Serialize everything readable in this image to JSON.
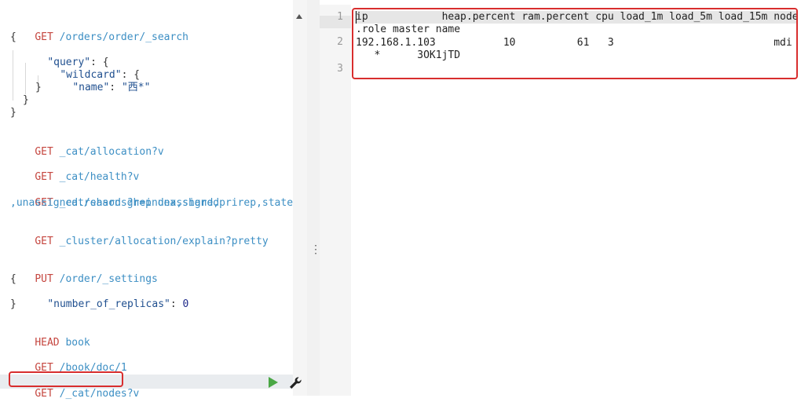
{
  "editor": {
    "lines": [
      {
        "method": "GET",
        "path": "/orders/order/_search"
      },
      {
        "text": "{"
      },
      {
        "key": "\"query\"",
        "rest": ": {"
      },
      {
        "key": "\"wildcard\"",
        "rest": ": {"
      },
      {
        "key": "\"name\"",
        "mid": ": ",
        "str": "\"西*\""
      },
      {
        "text": "}"
      },
      {
        "text": "}"
      },
      {
        "text": "}"
      },
      {
        "method": "GET",
        "path": "_cat/allocation?v"
      },
      {
        "method": "GET",
        "path": "_cat/health?v"
      },
      {
        "method": "GET",
        "path": "_cat/shards?h=index,shard,prirep,state"
      },
      {
        "path": ",unassigned.reason grep unassigned"
      },
      {
        "method": "GET",
        "path": "_cluster/allocation/explain?pretty"
      },
      {
        "method": "PUT",
        "path": "/order/_settings"
      },
      {
        "text": "{"
      },
      {
        "key": "\"number_of_replicas\"",
        "mid": ": ",
        "num": "0"
      },
      {
        "text": "}"
      },
      {
        "method": "HEAD",
        "path": "book"
      },
      {
        "method": "GET",
        "path": "/book/doc/1"
      },
      {
        "method": "GET",
        "path": "/_cat/nodes?v"
      }
    ]
  },
  "response": {
    "line_numbers": [
      "1",
      "2",
      "3"
    ],
    "lines": [
      "ip            heap.percent ram.percent cpu load_1m load_5m load_15m node",
      ".role master name",
      "192.168.1.103           10          61   3                          mdi",
      "   *      3OK1jTD"
    ]
  },
  "icons": {
    "run": "play-icon",
    "settings": "wrench-icon",
    "scroll_up": "chevron-up-icon",
    "divider": "vertical-dots-icon"
  },
  "colors": {
    "method": "#c5463f",
    "path": "#3d8fc4",
    "highlight_box": "#d82e2e",
    "run": "#4aa745"
  }
}
